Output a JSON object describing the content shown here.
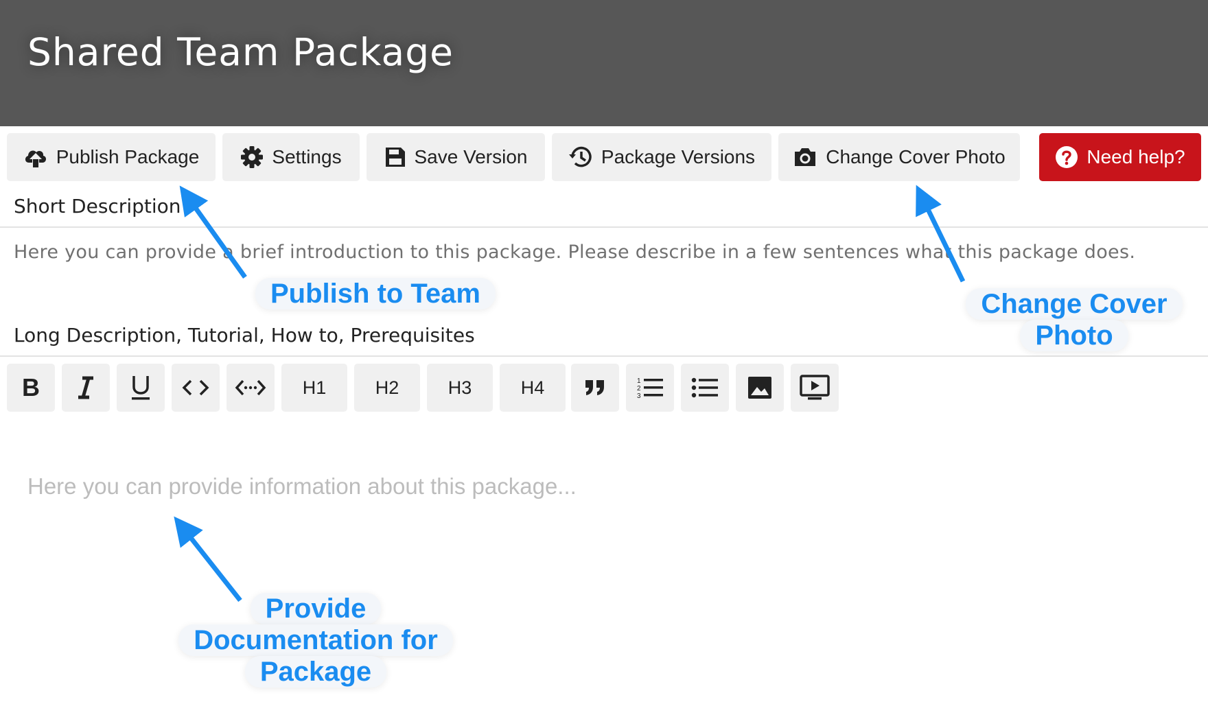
{
  "header": {
    "title": "Shared Team Package"
  },
  "toolbar": {
    "publish": "Publish Package",
    "settings": "Settings",
    "save_version": "Save Version",
    "package_versions": "Package Versions",
    "change_cover": "Change Cover Photo",
    "help": "Need help?"
  },
  "short_description": {
    "label": "Short Description",
    "text": "Here you can provide a brief introduction to this package. Please describe in a few sentences what this package does."
  },
  "long_description": {
    "label": "Long Description, Tutorial, How to, Prerequisites",
    "placeholder": "Here you can provide information about this package..."
  },
  "format_toolbar": {
    "bold": "B",
    "h1": "H1",
    "h2": "H2",
    "h3": "H3",
    "h4": "H4",
    "icons": [
      "bold-icon",
      "italic-icon",
      "underline-icon",
      "code-icon",
      "code-block-icon",
      "quote-icon",
      "ordered-list-icon",
      "bullet-list-icon",
      "image-icon",
      "video-icon"
    ]
  },
  "callouts": {
    "publish": "Publish to Team",
    "cover_line1": "Change Cover",
    "cover_line2": "Photo",
    "docs_line1": "Provide",
    "docs_line2": "Documentation for",
    "docs_line3": "Package"
  },
  "colors": {
    "header_bg": "#575757",
    "button_bg": "#f0f0f0",
    "help_bg": "#c8141b",
    "callout_blue": "#1a8cf0"
  }
}
